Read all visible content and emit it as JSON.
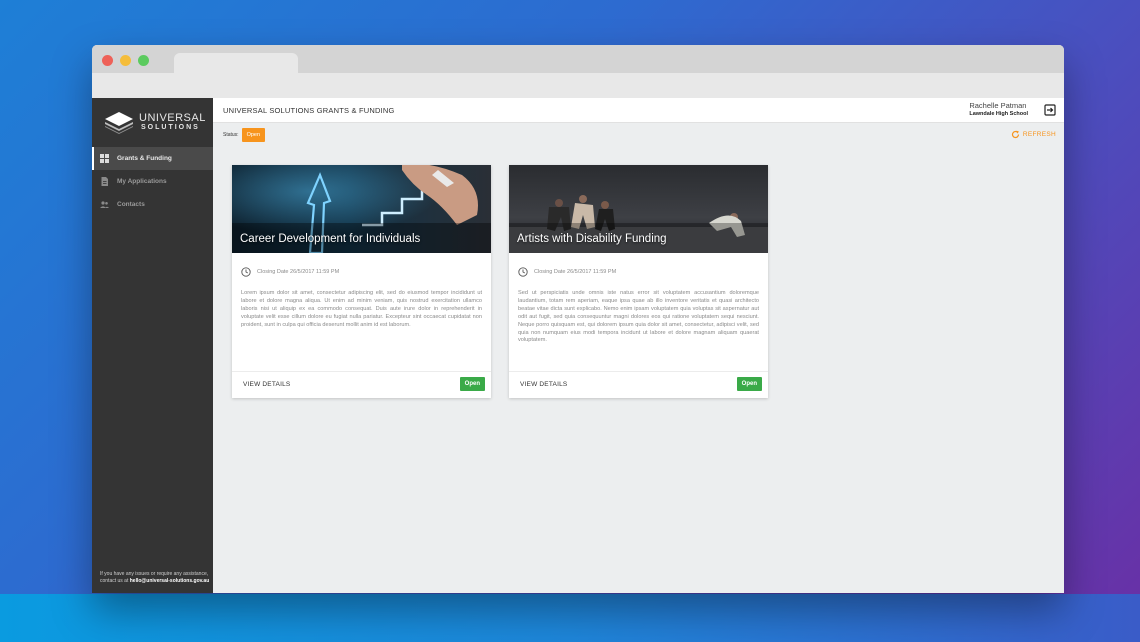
{
  "app": {
    "logo": {
      "word1": "UNIVERSAL",
      "word2": "SOLUTIONS"
    },
    "header_title": "UNIVERSAL SOLUTIONS GRANTS & FUNDING",
    "user": {
      "name": "Rachelle Patman",
      "school": "Lawndale High School"
    }
  },
  "sidebar": {
    "items": [
      {
        "label": "Grants & Funding",
        "icon": "grid-icon",
        "active": true
      },
      {
        "label": "My Applications",
        "icon": "document-icon",
        "active": false
      },
      {
        "label": "Contacts",
        "icon": "people-icon",
        "active": false
      }
    ],
    "help_text": "If you have any issues or require any assistance, contact us at",
    "help_email": "hello@universal-solutions.gov.au"
  },
  "filter": {
    "label": "Status:",
    "value": "Open"
  },
  "refresh_label": "REFRESH",
  "cards": [
    {
      "title": "Career Development for Individuals",
      "closing": "Closing Date 26/5/2017 11:59 PM",
      "body": "Lorem ipsum dolor sit amet, consectetur adipiscing elit, sed do eiusmod tempor incididunt ut labore et dolore magna aliqua. Ut enim ad minim veniam, quis nostrud exercitation ullamco laboris nisi ut aliquip ex ea commodo consequat. Duis aute irure dolor in reprehenderit in voluptate velit esse cillum dolore eu fugiat nulla pariatur. Excepteur sint occaecat cupidatat non proident, sunt in culpa qui officia deserunt mollit anim id est laborum.",
      "view_label": "VIEW DETAILS",
      "status": "Open"
    },
    {
      "title": "Artists with Disability Funding",
      "closing": "Closing Date 26/5/2017 11:59 PM",
      "body": "Sed ut perspiciatis unde omnis iste natus error sit voluptatem accusantium doloremque laudantium, totam rem aperiam, eaque ipsa quae ab illo inventore veritatis et quasi architecto beatae vitae dicta sunt explicabo. Nemo enim ipsam voluptatem quia voluptas sit aspernatur aut odit aut fugit, sed quia consequuntur magni dolores eos qui ratione voluptatem sequi nesciunt. Neque porro quisquam est, qui dolorem ipsum quia dolor sit amet, consectetur, adipisci velit, sed quia non numquam eius modi tempora incidunt ut labore et dolore magnam aliquam quaerat voluptatem.",
      "view_label": "VIEW DETAILS",
      "status": "Open"
    }
  ],
  "colors": {
    "accent_orange": "#f7941d",
    "open_green": "#3aaa48",
    "sidebar_bg": "#343434"
  }
}
